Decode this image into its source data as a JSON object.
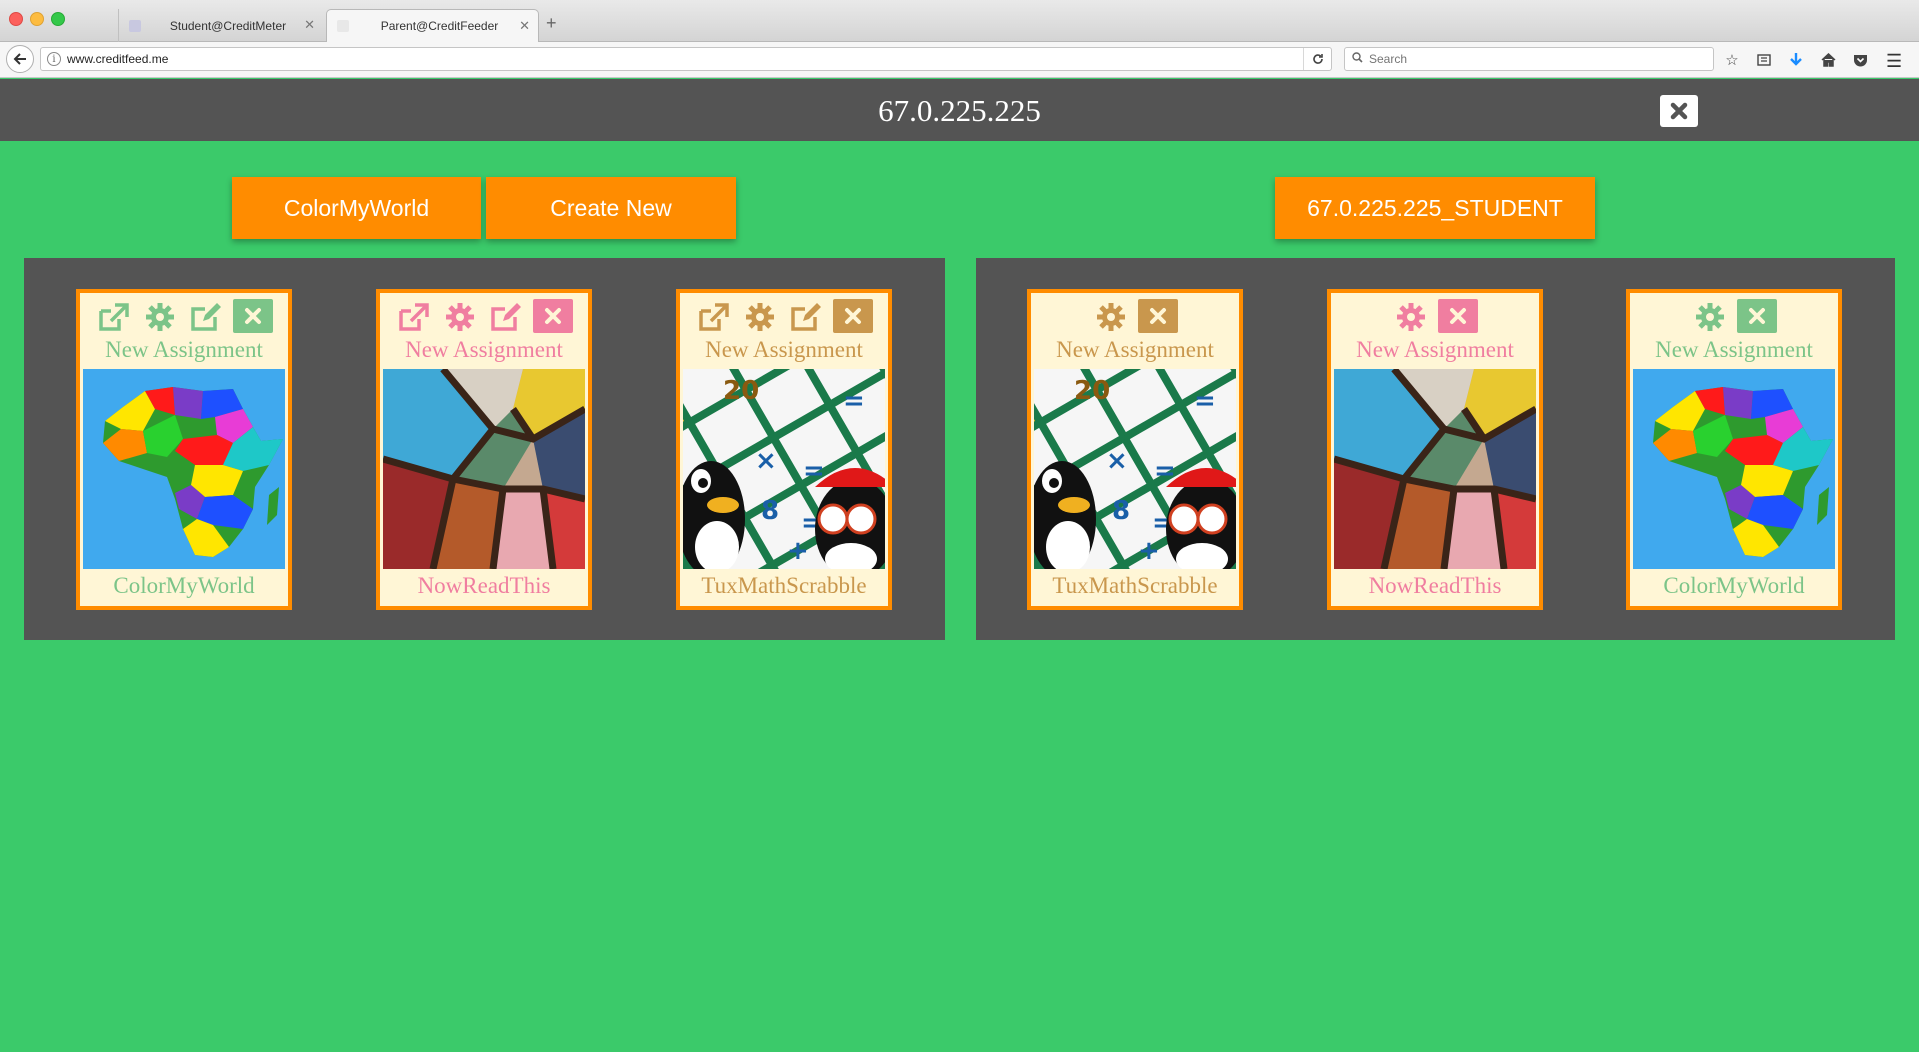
{
  "browser": {
    "tabs": [
      {
        "label": "Student@CreditMeter",
        "active": false
      },
      {
        "label": "Parent@CreditFeeder",
        "active": true
      }
    ],
    "url": "www.creditfeed.me",
    "search_placeholder": "Search"
  },
  "header": {
    "title": "67.0.225.225"
  },
  "buttons": {
    "color_my_world": "ColorMyWorld",
    "create_new": "Create New",
    "student": "67.0.225.225_STUDENT"
  },
  "parent_cards": [
    {
      "subtitle": "New Assignment",
      "name": "ColorMyWorld",
      "theme": "green",
      "thumbnail": "africa-map"
    },
    {
      "subtitle": "New Assignment",
      "name": "NowReadThis",
      "theme": "pink",
      "thumbnail": "stained-glass"
    },
    {
      "subtitle": "New Assignment",
      "name": "TuxMathScrabble",
      "theme": "tan",
      "thumbnail": "tux-math"
    }
  ],
  "student_cards": [
    {
      "subtitle": "New Assignment",
      "name": "TuxMathScrabble",
      "theme": "tan",
      "thumbnail": "tux-math"
    },
    {
      "subtitle": "New Assignment",
      "name": "NowReadThis",
      "theme": "pink",
      "thumbnail": "stained-glass"
    },
    {
      "subtitle": "New Assignment",
      "name": "ColorMyWorld",
      "theme": "green",
      "thumbnail": "africa-map"
    }
  ],
  "colors": {
    "background": "#3bca6a",
    "header": "#545454",
    "accent_orange": "#ff8c00",
    "card_bg": "#fff6d6",
    "green": "#7cc488",
    "pink": "#f07ea0",
    "tan": "#c9974d"
  }
}
